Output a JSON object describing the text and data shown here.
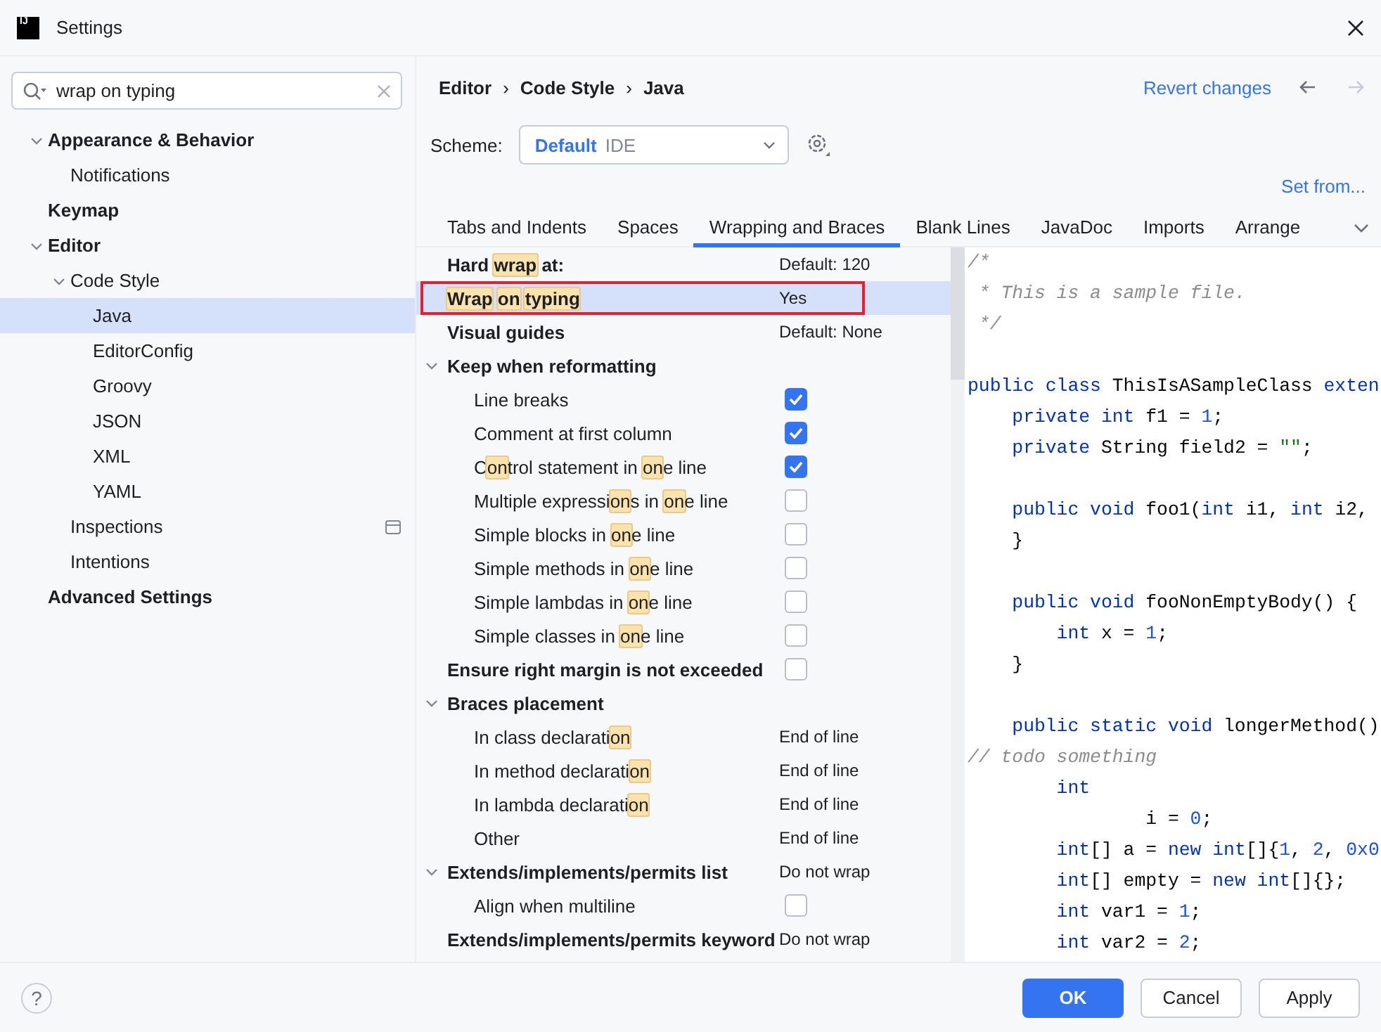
{
  "window": {
    "title": "Settings",
    "app_icon": "IJ"
  },
  "search": {
    "value": "wrap on typing"
  },
  "sidebar": {
    "items": [
      {
        "label": "Appearance & Behavior",
        "expanded": true,
        "selected": false,
        "children": [
          {
            "label": "Notifications",
            "selected": false
          }
        ]
      },
      {
        "label": "Keymap",
        "selected": false
      },
      {
        "label": "Editor",
        "expanded": true,
        "selected": false,
        "children": [
          {
            "label": "Code Style",
            "expanded": true,
            "selected": false,
            "children": [
              {
                "label": "Java",
                "selected": true
              },
              {
                "label": "EditorConfig",
                "selected": false
              },
              {
                "label": "Groovy",
                "selected": false
              },
              {
                "label": "JSON",
                "selected": false
              },
              {
                "label": "XML",
                "selected": false
              },
              {
                "label": "YAML",
                "selected": false
              }
            ]
          },
          {
            "label": "Inspections",
            "selected": false,
            "kind": "panel"
          },
          {
            "label": "Intentions",
            "selected": false
          }
        ]
      },
      {
        "label": "Advanced Settings",
        "selected": false
      }
    ]
  },
  "breadcrumb": [
    {
      "kind": "crumb",
      "text": "Editor"
    },
    {
      "kind": "separator",
      "text": "›"
    },
    {
      "kind": "crumb",
      "text": "Code Style"
    },
    {
      "kind": "separator",
      "text": "›"
    },
    {
      "kind": "crumb",
      "text": "Java"
    }
  ],
  "revert_link": "Revert changes",
  "nav": {
    "back_enabled": true,
    "forward_enabled": false
  },
  "scheme": {
    "label": "Scheme:",
    "name": "Default",
    "source": "IDE"
  },
  "set_from_link": "Set from...",
  "tabs": [
    {
      "label": "Tabs and Indents",
      "selected": false
    },
    {
      "label": "Spaces",
      "selected": false
    },
    {
      "label": "Wrapping and Braces",
      "selected": true
    },
    {
      "label": "Blank Lines",
      "selected": false
    },
    {
      "label": "JavaDoc",
      "selected": false
    },
    {
      "label": "Imports",
      "selected": false
    },
    {
      "label": "Arrange",
      "selected": false
    }
  ],
  "settings": {
    "rows": [
      {
        "kind": "value",
        "label": [
          {
            "text": "Hard ",
            "match": false
          },
          {
            "text": "wrap",
            "match": true
          },
          {
            "text": " at:",
            "match": false
          }
        ],
        "value": "Default: 120",
        "selected": false,
        "outlined": false
      },
      {
        "kind": "value",
        "label": [
          {
            "text": "Wrap on typing",
            "match": true
          }
        ],
        "value": "Yes",
        "selected": true,
        "outlined": true
      },
      {
        "kind": "value",
        "label": [
          {
            "text": "Visual guides",
            "match": false
          }
        ],
        "value": "Default: None",
        "selected": false,
        "outlined": false
      },
      {
        "kind": "group",
        "label": [
          {
            "text": "Keep when reformatting",
            "match": false
          }
        ],
        "expanded": true,
        "selected": false,
        "outlined": false,
        "children": [
          {
            "kind": "checkbox",
            "label": [
              {
                "text": "Line breaks",
                "match": false
              }
            ],
            "checked": true,
            "selected": false
          },
          {
            "kind": "checkbox",
            "label": [
              {
                "text": "Comment at first column",
                "match": false
              }
            ],
            "checked": true,
            "selected": false
          },
          {
            "kind": "checkbox",
            "label": [
              {
                "text": "C",
                "match": false
              },
              {
                "text": "on",
                "match": true
              },
              {
                "text": "trol statement in ",
                "match": false
              },
              {
                "text": "on",
                "match": true
              },
              {
                "text": "e line",
                "match": false
              }
            ],
            "checked": true,
            "selected": false
          },
          {
            "kind": "checkbox",
            "label": [
              {
                "text": "Multiple expressi",
                "match": false
              },
              {
                "text": "on",
                "match": true
              },
              {
                "text": "s in ",
                "match": false
              },
              {
                "text": "on",
                "match": true
              },
              {
                "text": "e line",
                "match": false
              }
            ],
            "checked": false,
            "selected": false
          },
          {
            "kind": "checkbox",
            "label": [
              {
                "text": "Simple blocks in ",
                "match": false
              },
              {
                "text": "on",
                "match": true
              },
              {
                "text": "e line",
                "match": false
              }
            ],
            "checked": false,
            "selected": false
          },
          {
            "kind": "checkbox",
            "label": [
              {
                "text": "Simple methods in ",
                "match": false
              },
              {
                "text": "on",
                "match": true
              },
              {
                "text": "e line",
                "match": false
              }
            ],
            "checked": false,
            "selected": false
          },
          {
            "kind": "checkbox",
            "label": [
              {
                "text": "Simple lambdas in ",
                "match": false
              },
              {
                "text": "on",
                "match": true
              },
              {
                "text": "e line",
                "match": false
              }
            ],
            "checked": false,
            "selected": false
          },
          {
            "kind": "checkbox",
            "label": [
              {
                "text": "Simple classes in ",
                "match": false
              },
              {
                "text": "on",
                "match": true
              },
              {
                "text": "e line",
                "match": false
              }
            ],
            "checked": false,
            "selected": false
          }
        ]
      },
      {
        "kind": "checkbox",
        "label": [
          {
            "text": "Ensure right margin is not exceeded",
            "match": false
          }
        ],
        "checked": false,
        "selected": false,
        "outlined": false
      },
      {
        "kind": "group",
        "label": [
          {
            "text": "Braces placement",
            "match": false
          }
        ],
        "expanded": true,
        "selected": false,
        "outlined": false,
        "children": [
          {
            "kind": "value",
            "label": [
              {
                "text": "In class declarati",
                "match": false
              },
              {
                "text": "on",
                "match": true
              }
            ],
            "value": "End of line",
            "selected": false
          },
          {
            "kind": "value",
            "label": [
              {
                "text": "In method declarati",
                "match": false
              },
              {
                "text": "on",
                "match": true
              }
            ],
            "value": "End of line",
            "selected": false
          },
          {
            "kind": "value",
            "label": [
              {
                "text": "In lambda declarati",
                "match": false
              },
              {
                "text": "on",
                "match": true
              }
            ],
            "value": "End of line",
            "selected": false
          },
          {
            "kind": "value",
            "label": [
              {
                "text": "Other",
                "match": false
              }
            ],
            "value": "End of line",
            "selected": false
          }
        ]
      },
      {
        "kind": "group",
        "label": [
          {
            "text": "Extends/implements/permits list",
            "match": false
          }
        ],
        "value": "Do not wrap",
        "expanded": true,
        "selected": false,
        "outlined": false,
        "children": [
          {
            "kind": "checkbox",
            "label": [
              {
                "text": "Align when multiline",
                "match": false
              }
            ],
            "checked": false,
            "selected": false
          }
        ]
      },
      {
        "kind": "value",
        "label": [
          {
            "text": "Extends/implements/permits keyword",
            "match": false
          }
        ],
        "value": "Do not wrap",
        "selected": false,
        "outlined": false
      }
    ]
  },
  "preview": {
    "lines": [
      {
        "kind": "code",
        "tokens": [
          {
            "kind": "comment",
            "text": "/*"
          }
        ]
      },
      {
        "kind": "code",
        "tokens": [
          {
            "kind": "comment",
            "text": " * This is a sample file."
          }
        ]
      },
      {
        "kind": "code",
        "tokens": [
          {
            "kind": "comment",
            "text": " */"
          }
        ]
      },
      {
        "kind": "blank"
      },
      {
        "kind": "code",
        "tokens": [
          {
            "kind": "keyword",
            "text": "public class"
          },
          {
            "kind": "plain",
            "text": " ThisIsASampleClass "
          },
          {
            "kind": "keyword",
            "text": "exten"
          }
        ]
      },
      {
        "kind": "code",
        "tokens": [
          {
            "kind": "keyword",
            "text": "    private int"
          },
          {
            "kind": "plain",
            "text": " f1 = "
          },
          {
            "kind": "number",
            "text": "1"
          },
          {
            "kind": "plain",
            "text": ";"
          }
        ]
      },
      {
        "kind": "code",
        "tokens": [
          {
            "kind": "keyword",
            "text": "    private"
          },
          {
            "kind": "plain",
            "text": " String field2 = "
          },
          {
            "kind": "string",
            "text": "\"\""
          },
          {
            "kind": "plain",
            "text": ";"
          }
        ]
      },
      {
        "kind": "blank"
      },
      {
        "kind": "code",
        "tokens": [
          {
            "kind": "keyword",
            "text": "    public void"
          },
          {
            "kind": "plain",
            "text": " foo1("
          },
          {
            "kind": "keyword",
            "text": "int"
          },
          {
            "kind": "plain",
            "text": " i1, "
          },
          {
            "kind": "keyword",
            "text": "int"
          },
          {
            "kind": "plain",
            "text": " i2,"
          }
        ]
      },
      {
        "kind": "code",
        "tokens": [
          {
            "kind": "plain",
            "text": "    }"
          }
        ]
      },
      {
        "kind": "blank"
      },
      {
        "kind": "code",
        "tokens": [
          {
            "kind": "keyword",
            "text": "    public void"
          },
          {
            "kind": "plain",
            "text": " fooNonEmptyBody() {"
          }
        ]
      },
      {
        "kind": "code",
        "tokens": [
          {
            "kind": "keyword",
            "text": "        int"
          },
          {
            "kind": "plain",
            "text": " x = "
          },
          {
            "kind": "number",
            "text": "1"
          },
          {
            "kind": "plain",
            "text": ";"
          }
        ]
      },
      {
        "kind": "code",
        "tokens": [
          {
            "kind": "plain",
            "text": "    }"
          }
        ]
      },
      {
        "kind": "blank"
      },
      {
        "kind": "code",
        "tokens": [
          {
            "kind": "keyword",
            "text": "    public static void"
          },
          {
            "kind": "plain",
            "text": " longerMethod()"
          }
        ]
      },
      {
        "kind": "code",
        "tokens": [
          {
            "kind": "comment",
            "text": "// todo something"
          }
        ]
      },
      {
        "kind": "code",
        "tokens": [
          {
            "kind": "keyword",
            "text": "        int"
          }
        ]
      },
      {
        "kind": "code",
        "tokens": [
          {
            "kind": "plain",
            "text": "                i = "
          },
          {
            "kind": "number",
            "text": "0"
          },
          {
            "kind": "plain",
            "text": ";"
          }
        ]
      },
      {
        "kind": "code",
        "tokens": [
          {
            "kind": "keyword",
            "text": "        int"
          },
          {
            "kind": "plain",
            "text": "[] a = "
          },
          {
            "kind": "keyword",
            "text": "new int"
          },
          {
            "kind": "plain",
            "text": "[]{"
          },
          {
            "kind": "number",
            "text": "1"
          },
          {
            "kind": "plain",
            "text": ", "
          },
          {
            "kind": "number",
            "text": "2"
          },
          {
            "kind": "plain",
            "text": ", "
          },
          {
            "kind": "number",
            "text": "0x0"
          }
        ]
      },
      {
        "kind": "code",
        "tokens": [
          {
            "kind": "keyword",
            "text": "        int"
          },
          {
            "kind": "plain",
            "text": "[] empty = "
          },
          {
            "kind": "keyword",
            "text": "new int"
          },
          {
            "kind": "plain",
            "text": "[]{};"
          }
        ]
      },
      {
        "kind": "code",
        "tokens": [
          {
            "kind": "keyword",
            "text": "        int"
          },
          {
            "kind": "plain",
            "text": " var1 = "
          },
          {
            "kind": "number",
            "text": "1"
          },
          {
            "kind": "plain",
            "text": ";"
          }
        ]
      },
      {
        "kind": "code",
        "tokens": [
          {
            "kind": "keyword",
            "text": "        int"
          },
          {
            "kind": "plain",
            "text": " var2 = "
          },
          {
            "kind": "number",
            "text": "2"
          },
          {
            "kind": "plain",
            "text": ";"
          }
        ]
      }
    ]
  },
  "footer": {
    "help": "?",
    "buttons": [
      {
        "label": "OK",
        "kind": "primary"
      },
      {
        "label": "Cancel",
        "kind": "default"
      },
      {
        "label": "Apply",
        "kind": "default"
      }
    ]
  }
}
